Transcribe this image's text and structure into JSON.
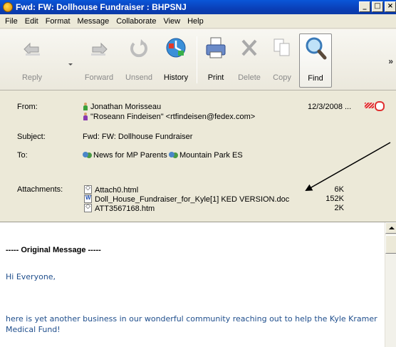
{
  "window": {
    "title": "Fwd: FW: Dollhouse Fundraiser : BHPSNJ",
    "app_icon": "mail-app-icon",
    "controls": [
      "minimize",
      "maximize",
      "close"
    ]
  },
  "menu": [
    "File",
    "Edit",
    "Format",
    "Message",
    "Collaborate",
    "View",
    "Help"
  ],
  "toolbar": {
    "buttons": [
      {
        "label": "Reply",
        "icon": "reply-icon",
        "enabled": false
      },
      {
        "label": "Forward",
        "icon": "forward-icon",
        "enabled": false
      },
      {
        "label": "Unsend",
        "icon": "unsend-icon",
        "enabled": false
      },
      {
        "label": "History",
        "icon": "history-icon",
        "enabled": true
      },
      {
        "label": "Print",
        "icon": "print-icon",
        "enabled": true
      },
      {
        "label": "Delete",
        "icon": "delete-icon",
        "enabled": false
      },
      {
        "label": "Copy",
        "icon": "copy-icon",
        "enabled": false
      },
      {
        "label": "Find",
        "icon": "find-icon",
        "enabled": true
      }
    ]
  },
  "header": {
    "from_label": "From:",
    "from": [
      {
        "name": "Jonathan Morisseau",
        "color": "#3aa03a"
      },
      {
        "name": "\"Roseann Findeisen\" <rtfindeisen@fedex.com>",
        "color": "#8a3ab0"
      }
    ],
    "date": "12/3/2008 ...",
    "subject_label": "Subject:",
    "subject": "Fwd: FW: Dollhouse Fundraiser",
    "to_label": "To:",
    "to": [
      "News for MP Parents",
      "Mountain Park ES"
    ],
    "attachments_label": "Attachments:",
    "attachments": [
      {
        "name": "Attach0.html",
        "size": "6K",
        "type": "html"
      },
      {
        "name": "Doll_House_Fundraiser_for_Kyle[1] KED VERSION.doc",
        "size": "152K",
        "type": "word"
      },
      {
        "name": "ATT3567168.htm",
        "size": "2K",
        "type": "html"
      }
    ]
  },
  "body": {
    "original_message": "----- Original Message -----",
    "greeting": "Hi Everyone,",
    "paragraph": "here is yet another business in our wonderful community reaching out to help the Kyle Kramer Medical Fund!"
  },
  "colors": {
    "titlebar": "#0a46c8",
    "body_text": "#1f4e8c",
    "arrow": "#000000"
  }
}
